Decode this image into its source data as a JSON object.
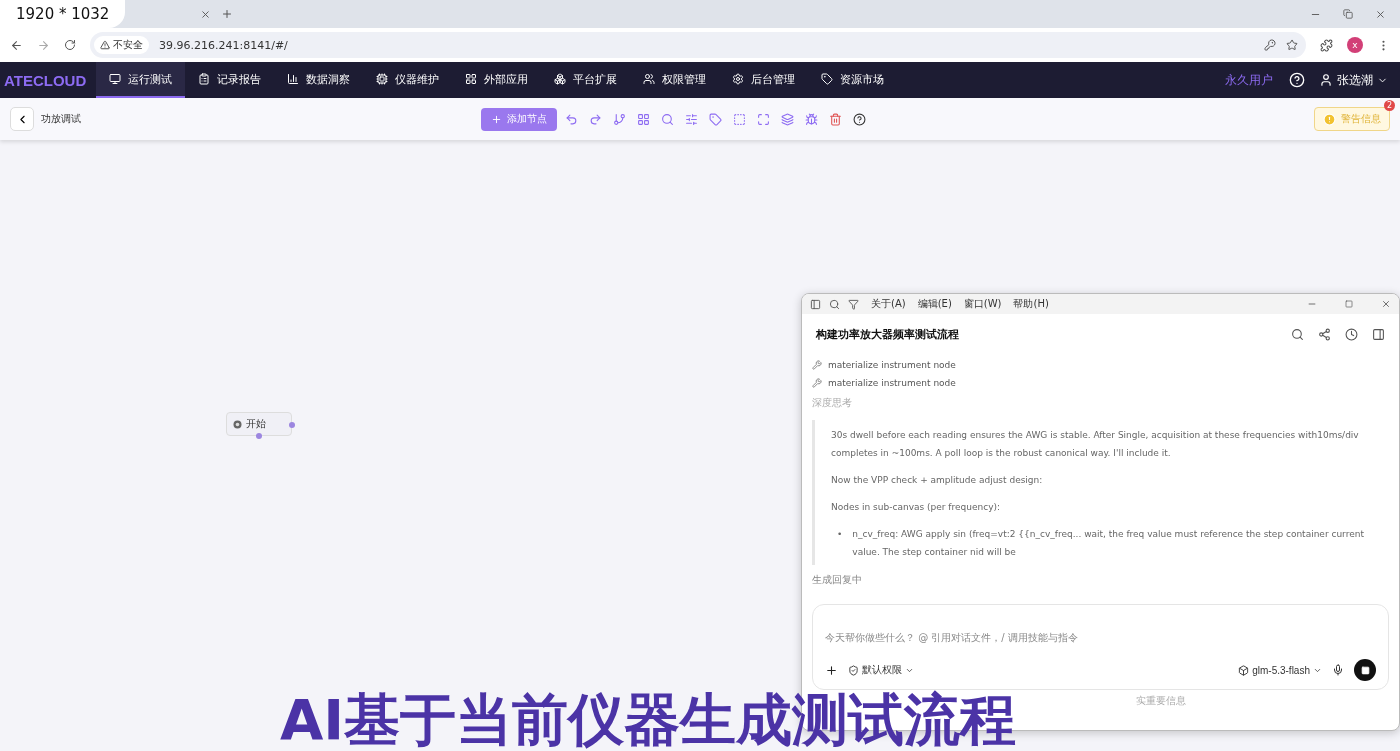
{
  "overlay_badge": "1920 * 1032",
  "browser": {
    "security_label": "不安全",
    "url": "39.96.216.241:8141/#/",
    "profile_initial": "x"
  },
  "app": {
    "logo": "ATECLOUD",
    "nav": [
      {
        "label": "运行测试",
        "selected": true
      },
      {
        "label": "记录报告",
        "selected": false
      },
      {
        "label": "数据洞察",
        "selected": false
      },
      {
        "label": "仪器维护",
        "selected": false
      },
      {
        "label": "外部应用",
        "selected": false
      },
      {
        "label": "平台扩展",
        "selected": false
      },
      {
        "label": "权限管理",
        "selected": false
      },
      {
        "label": "后台管理",
        "selected": false
      },
      {
        "label": "资源市场",
        "selected": false
      }
    ],
    "user_tier": "永久用户",
    "user_name": "张选潮"
  },
  "toolbar": {
    "title": "功放调试",
    "add_button": "添加节点",
    "alert": {
      "label": "警告信息",
      "count": "2"
    }
  },
  "canvas": {
    "nodes": [
      {
        "label": "开始"
      }
    ]
  },
  "chat": {
    "menu": [
      "关于(A)",
      "编辑(E)",
      "窗口(W)",
      "帮助(H)"
    ],
    "title": "构建功率放大器频率测试流程",
    "tool_calls": [
      "materialize instrument node",
      "materialize instrument node"
    ],
    "thinking_label": "深度思考",
    "thinking": [
      {
        "kind": "paragraph",
        "text": "30s dwell before each reading ensures the AWG is stable. After Single, acquisition at these frequencies with10ms/div completes in ~100ms. A poll loop is the robust canonical way. I'll include it."
      },
      {
        "kind": "paragraph",
        "text": "Now the VPP check + amplitude adjust design:"
      },
      {
        "kind": "paragraph",
        "text": "Nodes in sub-canvas (per frequency):"
      },
      {
        "kind": "bullet",
        "marker": "•",
        "text": "n_cv_freq: AWG apply sin (freq=vt:2 {{n_cv_freq... wait, the freq value must reference the step container current value. The step container nid will be"
      }
    ],
    "status": "生成回复中",
    "input": {
      "placeholder": "今天帮你做些什么？ @ 引用对话文件，/ 调用技能与指令",
      "permission": "默认权限",
      "model": "glm-5.3-flash"
    },
    "footer": "实重要信息"
  },
  "caption": "AI基于当前仪器生成测试流程"
}
